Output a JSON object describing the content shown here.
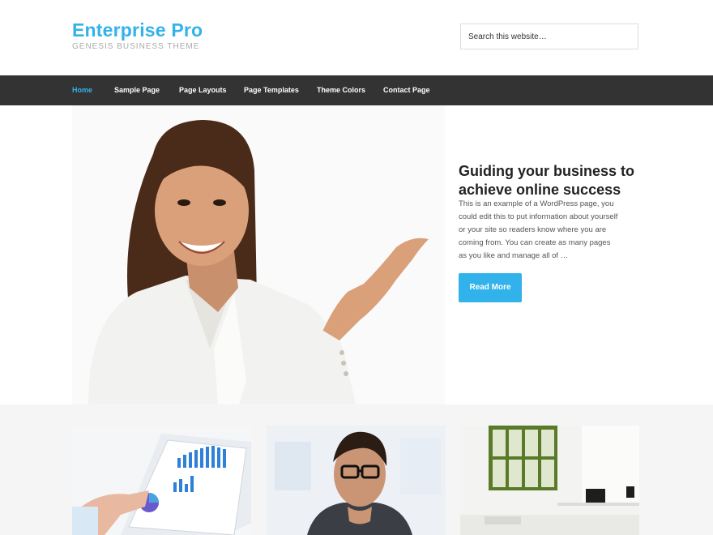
{
  "site": {
    "title": "Enterprise Pro",
    "tagline": "GENESIS BUSINESS THEME"
  },
  "search": {
    "placeholder": "Search this website…"
  },
  "nav": {
    "items": [
      {
        "label": "Home",
        "active": true
      },
      {
        "label": "Sample Page"
      },
      {
        "label": "Page Layouts"
      },
      {
        "label": "Page Templates"
      },
      {
        "label": "Theme Colors"
      },
      {
        "label": "Contact Page"
      }
    ]
  },
  "hero": {
    "title": "Guiding your business to achieve online success",
    "text": "This is an example of a WordPress page, you could edit this to put information about yourself or your site so readers know where you are coming from. You can create as many pages as you like and manage all of …",
    "button_label": "Read More"
  },
  "colors": {
    "accent": "#31b2ea",
    "nav_bg": "#333333",
    "strip_bg": "#f5f5f5"
  }
}
